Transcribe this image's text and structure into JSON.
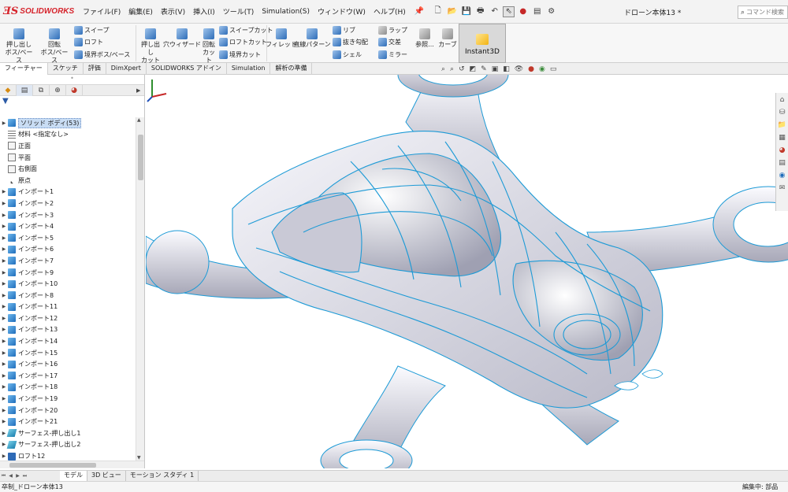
{
  "app": {
    "logo_mark": "ƎS",
    "logo_text": "SOLIDWORKS",
    "document_title": "ドローン本体13 *"
  },
  "menu": [
    "ファイル(F)",
    "編集(E)",
    "表示(V)",
    "挿入(I)",
    "ツール(T)",
    "Simulation(S)",
    "ウィンドウ(W)",
    "ヘルプ(H)"
  ],
  "search": {
    "placeholder": "コマンド検索"
  },
  "ribbon": {
    "extrude_boss": "押し出し\nボス/ベース",
    "revolve_boss": "回転\nボス/ベース",
    "sweep": "スイープ",
    "loft": "ロフト",
    "boundary_boss": "境界ボス/ベース",
    "extrude_cut": "押し出し\nカット",
    "hole_wizard": "穴ウィザード",
    "revolve_cut": "回転\nカット",
    "sweep_cut": "スイープカット",
    "loft_cut": "ロフトカット",
    "boundary_cut": "境界カット",
    "fillet": "フィレット",
    "linear_pattern": "直線パターン",
    "rib": "リブ",
    "draft": "抜き勾配",
    "shell": "シェル",
    "wrap": "ラップ",
    "intersect": "交差",
    "mirror": "ミラー",
    "reference": "参照...",
    "curves": "カーブ",
    "instant3d": "Instant3D"
  },
  "tabs": [
    "フィーチャー",
    "スケッチ",
    "評価",
    "DimXpert",
    "SOLIDWORKS アドイン",
    "Simulation",
    "解析の準備"
  ],
  "tree": {
    "solid_bodies": "ソリッド ボディ(53)",
    "material": "材料 <指定なし>",
    "front_plane": "正面",
    "top_plane": "平面",
    "right_plane": "右側面",
    "origin": "原点",
    "imports": [
      "インポート1",
      "インポート2",
      "インポート3",
      "インポート4",
      "インポート5",
      "インポート6",
      "インポート7",
      "インポート9",
      "インポート10",
      "インポート8",
      "インポート11",
      "インポート12",
      "インポート13",
      "インポート14",
      "インポート15",
      "インポート16",
      "インポート17",
      "インポート18",
      "インポート19",
      "インポート20",
      "インポート21"
    ],
    "surface_extrude_1": "サーフェス-押し出し1",
    "surface_extrude_2": "サーフェス-押し出し2",
    "loft_12": "ロフト12"
  },
  "bottom_tabs": [
    "モデル",
    "3D ビュー",
    "モーション スタディ 1"
  ],
  "status": {
    "left": "卒制_ドローン本体13",
    "right": "編集中: 部品"
  },
  "colors": {
    "brand": "#d6232b",
    "wire": "#1c9ad6",
    "body": "#e6e6ee",
    "selection": "#c9ddf4"
  }
}
